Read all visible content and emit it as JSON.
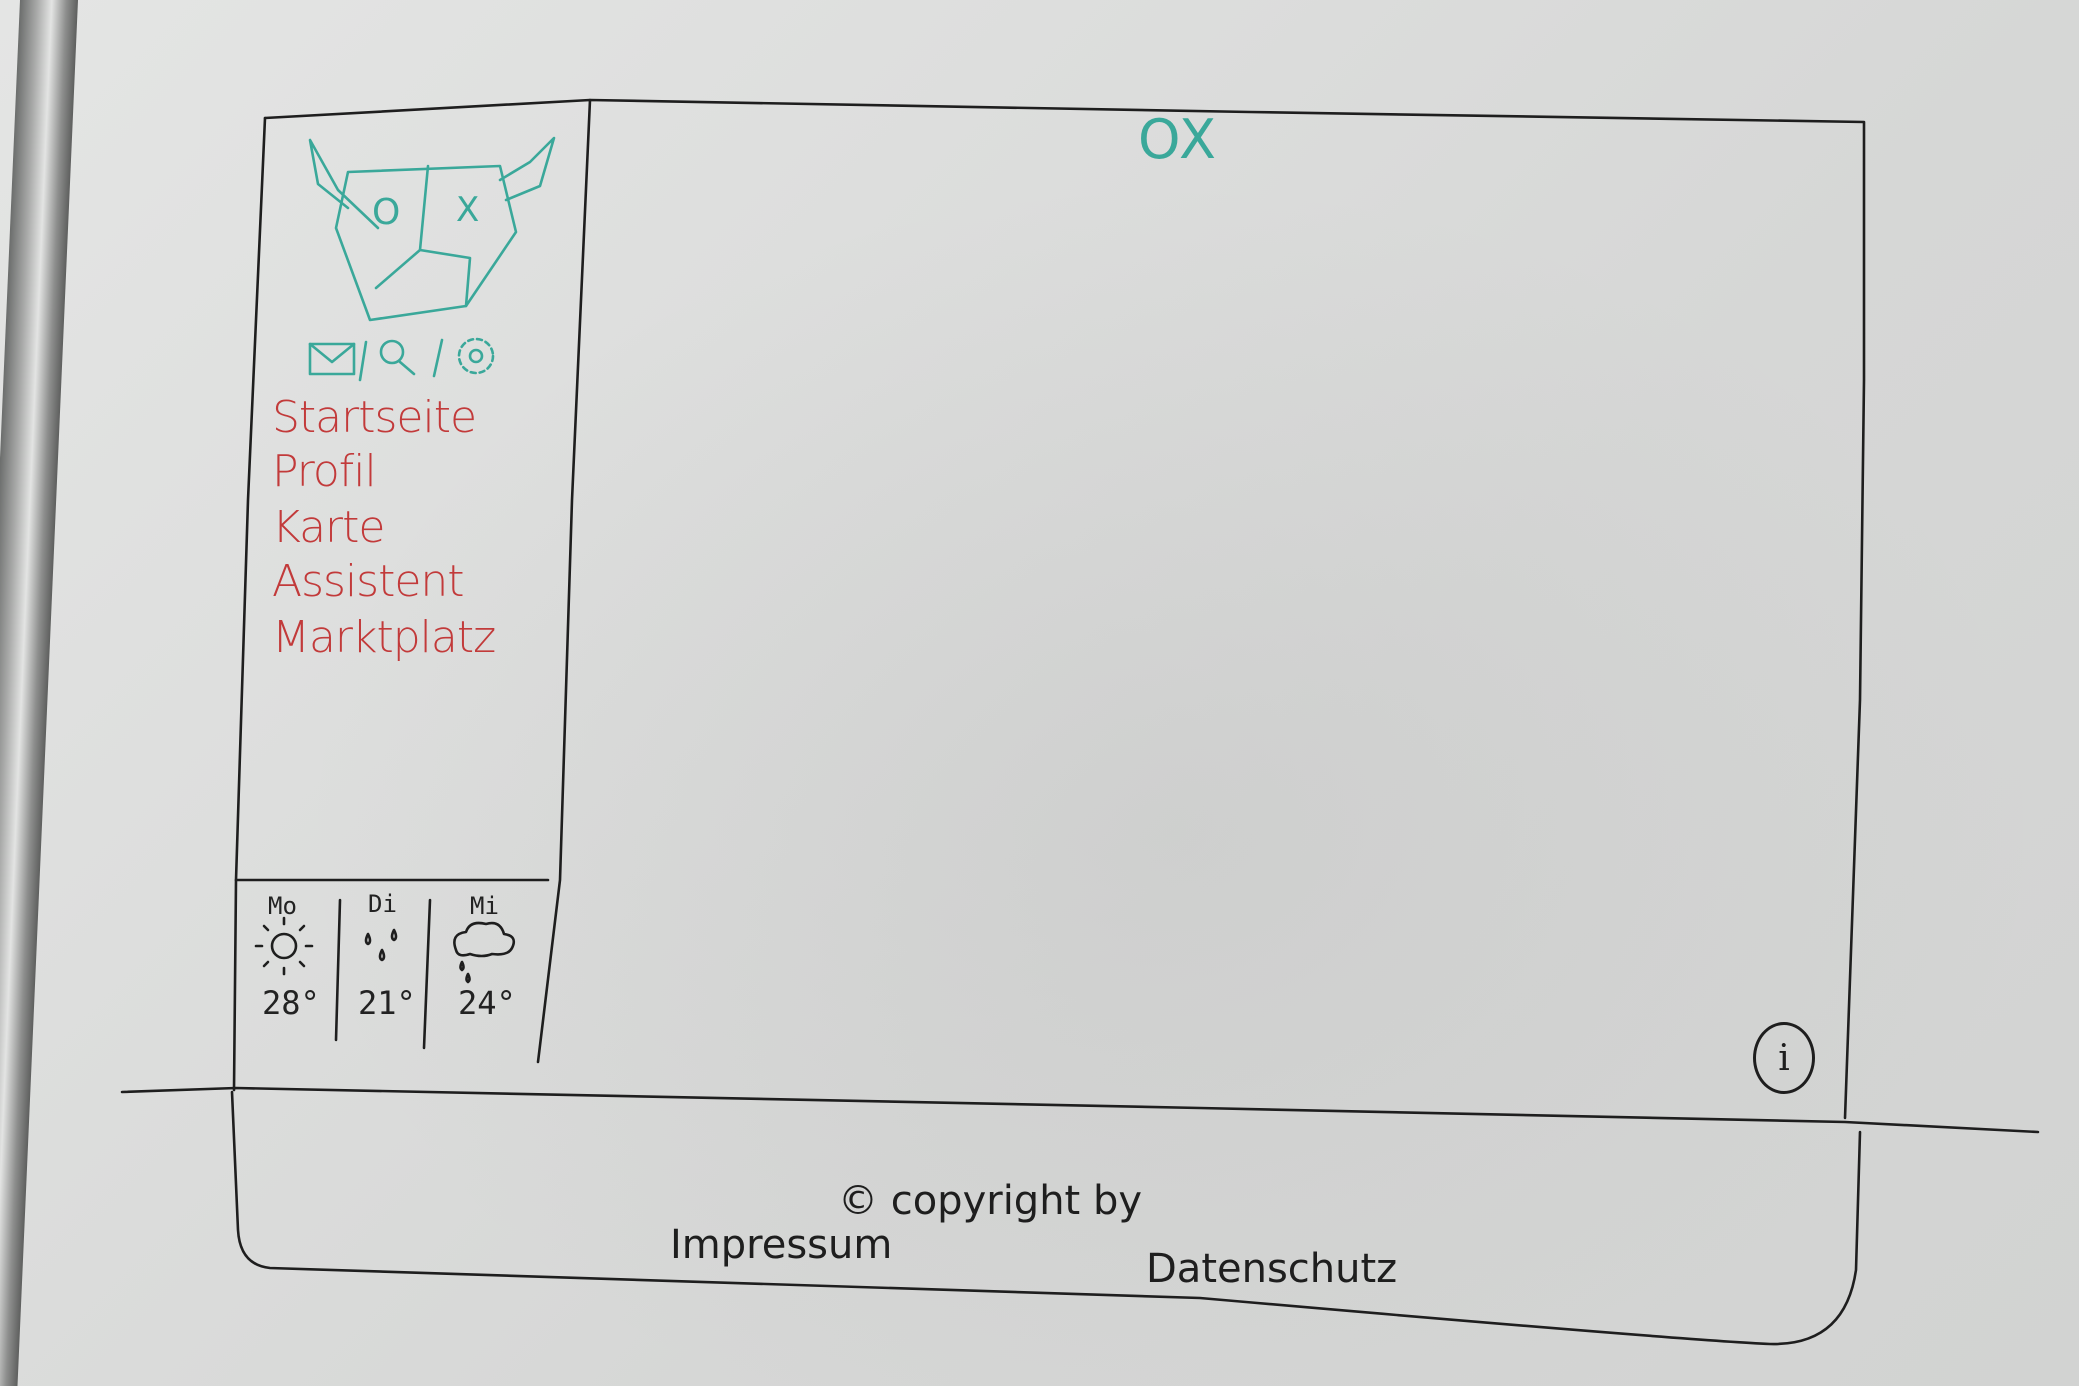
{
  "brand": {
    "logo_left": "O",
    "logo_right": "X",
    "name": "OX",
    "accent_color": "#3aa89a"
  },
  "toolbar": {
    "icons": [
      "mail-icon",
      "search-icon",
      "settings-icon"
    ]
  },
  "nav": {
    "color": "#c23a3a",
    "items": [
      {
        "label": "Startseite"
      },
      {
        "label": "Profil"
      },
      {
        "label": "Karte"
      },
      {
        "label": "Assistent"
      },
      {
        "label": "Marktplatz"
      }
    ]
  },
  "weather": [
    {
      "day": "Mo",
      "icon": "sun-icon",
      "temp": "28°"
    },
    {
      "day": "Di",
      "icon": "rain-icon",
      "temp": "21°"
    },
    {
      "day": "Mi",
      "icon": "cloud-rain-icon",
      "temp": "24°"
    }
  ],
  "info": {
    "label": "i",
    "icon": "info-icon"
  },
  "footer": {
    "copyright": "© copyright by",
    "impressum": "Impressum",
    "datenschutz": "Datenschutz"
  }
}
